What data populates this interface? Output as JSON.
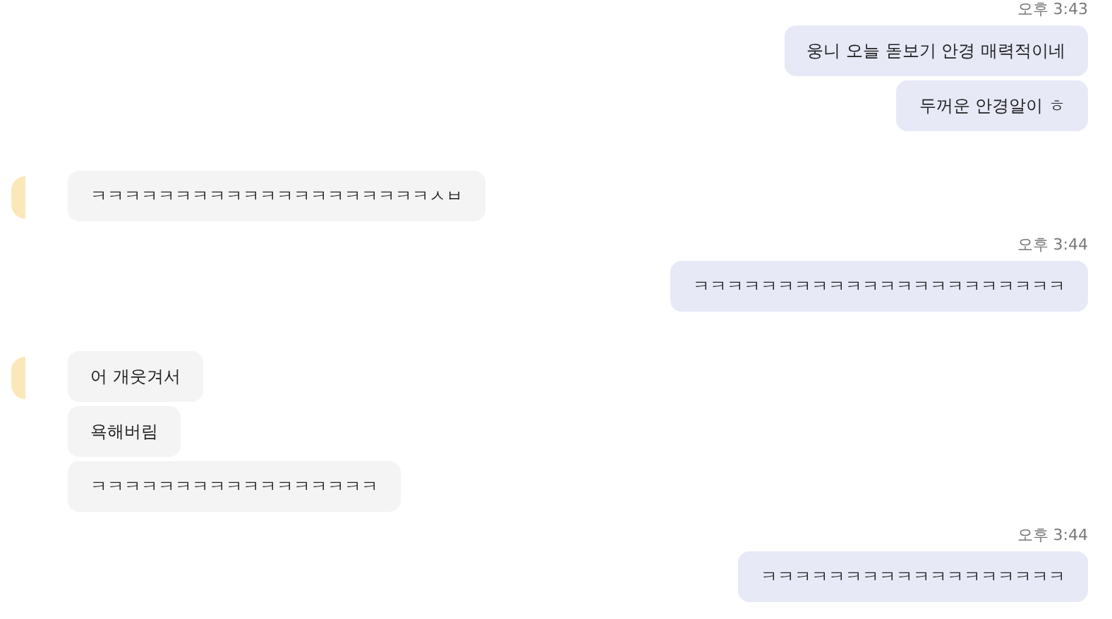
{
  "messages": [
    {
      "outgoing": true,
      "time": "오후 3:43",
      "bubbles": [
        "웅니 오늘 돋보기 안경 매력적이네",
        "두꺼운 안경알이 ㅎ"
      ]
    },
    {
      "outgoing": false,
      "bubbles": [
        "ㅋㅋㅋㅋㅋㅋㅋㅋㅋㅋㅋㅋㅋㅋㅋㅋㅋㅋㅋㅋㅅㅂ"
      ]
    },
    {
      "outgoing": true,
      "time": "오후 3:44",
      "bubbles": [
        "ㅋㅋㅋㅋㅋㅋㅋㅋㅋㅋㅋㅋㅋㅋㅋㅋㅋㅋㅋㅋㅋㅋ"
      ]
    },
    {
      "outgoing": false,
      "bubbles": [
        "어 개웃겨서",
        "욕해버림",
        "ㅋㅋㅋㅋㅋㅋㅋㅋㅋㅋㅋㅋㅋㅋㅋㅋㅋ"
      ]
    },
    {
      "outgoing": true,
      "time": "오후 3:44",
      "bubbles": [
        "ㅋㅋㅋㅋㅋㅋㅋㅋㅋㅋㅋㅋㅋㅋㅋㅋㅋㅋ"
      ]
    }
  ]
}
